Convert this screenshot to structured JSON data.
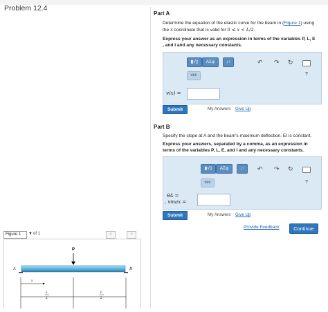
{
  "header": {
    "problem_title": "Problem 12.4"
  },
  "partA": {
    "label": "Part A",
    "prompt_pre": "Determine the equation of the elastic curve for the beam in (",
    "figure_link": "Figure 1",
    "prompt_post": ") using",
    "prompt_line2_pre": "the ",
    "prompt_var": "x",
    "prompt_line2_mid": " coordinate that is valid for ",
    "prompt_range": "0 ≤ x < L/2",
    "prompt_line2_end": ".",
    "instruction_line1": "Express your answer as an expression in terms of the variables P, L, E",
    "instruction_line2": ", and I and any necessary constants.",
    "toolbar": {
      "templates": "▮√▯",
      "greek": "ΑΣφ",
      "arrows": "↓↑",
      "vec": "vec"
    },
    "undo_icon": "↶",
    "redo_icon": "↷",
    "reset_icon": "↻",
    "help": "?",
    "eq_label": "v(x) =",
    "input_value": "",
    "submit": "Submit",
    "my_answers": "My Answers",
    "give_up": "Give Up"
  },
  "partB": {
    "label": "Part B",
    "prompt_line1": "Specify the slope at A and the beam's maximum deflection. EI is constant.",
    "instruction_line1": "Express your answers, separated by a comma, as an expression in",
    "instruction_line2": "terms of the variables P, L, E, and I and any necessary constants.",
    "toolbar": {
      "templates": "▮√▯",
      "greek": "ΑΣφ",
      "arrows": "↓↑",
      "vec": "vec"
    },
    "undo_icon": "↶",
    "redo_icon": "↷",
    "reset_icon": "↻",
    "help": "?",
    "eq_label_1": "θA =",
    "eq_label_2": ", vmax =",
    "input_value": "",
    "submit": "Submit",
    "my_answers": "My Answers",
    "give_up": "Give Up"
  },
  "footer": {
    "provide_feedback": "Provide Feedback",
    "continue": "Continue"
  },
  "figure": {
    "selector_value": "Figure 1",
    "of_text": "of 1",
    "prev": "<",
    "next": ">",
    "labels": {
      "load": "P",
      "support_a": "A",
      "support_b": "B",
      "axis": "x",
      "half1_num": "L",
      "half1_den": "2",
      "half2_num": "L",
      "half2_den": "2"
    }
  },
  "colors": {
    "accent": "#2e77bc",
    "panel": "#dbe9f5",
    "link": "#1a62b0"
  }
}
